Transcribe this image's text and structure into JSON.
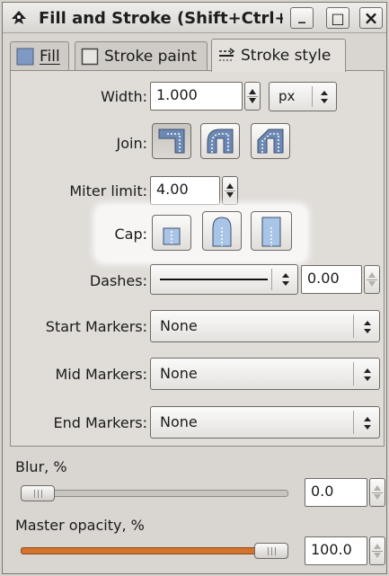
{
  "window": {
    "title": "Fill and Stroke (Shift+Ctrl+F)",
    "buttons": {
      "minimize": "_",
      "maximize": "□",
      "close": "×"
    }
  },
  "tabs": [
    {
      "label": "Fill",
      "icon": "fill-swatch-icon",
      "active": false
    },
    {
      "label": "Stroke paint",
      "icon": "stroke-paint-swatch-icon",
      "active": false
    },
    {
      "label": "Stroke style",
      "icon": "stroke-style-icon",
      "active": true
    }
  ],
  "stroke_style": {
    "width": {
      "label": "Width:",
      "value": "1.000",
      "unit": "px"
    },
    "join": {
      "label": "Join:",
      "options": [
        "miter-join-icon",
        "round-join-icon",
        "bevel-join-icon"
      ],
      "selected": 0
    },
    "miter_limit": {
      "label": "Miter limit:",
      "value": "4.00"
    },
    "cap": {
      "label": "Cap:",
      "options": [
        "butt-cap-icon",
        "round-cap-icon",
        "square-cap-icon"
      ]
    },
    "dashes": {
      "label": "Dashes:",
      "offset": "0.00"
    },
    "start_markers": {
      "label": "Start Markers:",
      "value": "None"
    },
    "mid_markers": {
      "label": "Mid Markers:",
      "value": "None"
    },
    "end_markers": {
      "label": "End Markers:",
      "value": "None"
    }
  },
  "blur": {
    "label": "Blur, %",
    "value": "0.0",
    "level": 0.0
  },
  "opacity": {
    "label": "Master opacity, %",
    "value": "100.0",
    "level": 1.0
  },
  "colors": {
    "accent": "#d4742c",
    "join_blue": "#6c89b4",
    "cap_blue": "#a8c4e6"
  }
}
